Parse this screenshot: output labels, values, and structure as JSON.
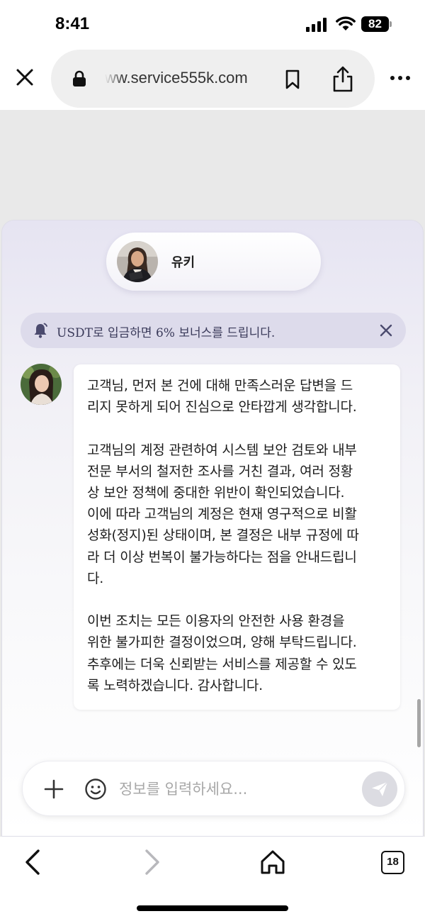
{
  "status_bar": {
    "time": "8:41",
    "battery_level": "82"
  },
  "browser": {
    "url": "ww.service555k.com",
    "icons": [
      "close-icon",
      "lock-icon",
      "bookmark-icon",
      "share-icon",
      "more-icon"
    ]
  },
  "chat": {
    "agent_name": "유키",
    "notice": {
      "text": "USDT로 입금하면 6% 보너스를 드립니다.",
      "icon": "bell-icon"
    },
    "messages": [
      {
        "sender": "agent",
        "text": "고객님, 먼저 본 건에 대해 만족스러운 답변을 드\n리지 못하게 되어 진심으로 안타깝게 생각합니다.\n\n고객님의 계정 관련하여 시스템 보안 검토와 내부\n전문 부서의 철저한 조사를 거친 결과, 여러 정황\n상 보안 정책에 중대한 위반이 확인되었습니다.\n이에 따라 고객님의 계정은 현재 영구적으로 비활\n성화(정지)된 상태이며, 본 결정은 내부 규정에 따\n라 더 이상 번복이 불가능하다는 점을 안내드립니\n다.\n\n이번 조치는 모든 이용자의 안전한 사용 환경을\n위한 불가피한 결정이었으며, 양해 부탁드립니다.\n추후에는 더욱 신뢰받는 서비스를 제공할 수 있도\n록 노력하겠습니다. 감사합니다."
      }
    ],
    "input": {
      "placeholder": "정보를 입력하세요...",
      "value": ""
    }
  },
  "toolbar": {
    "tab_count": "18",
    "icons": [
      "back-icon",
      "forward-icon",
      "home-icon",
      "tabs-icon"
    ]
  },
  "colors": {
    "notice_bg": "#dddbeb",
    "accent": "#4b4a6e",
    "send_disabled": "#dcdce2"
  }
}
